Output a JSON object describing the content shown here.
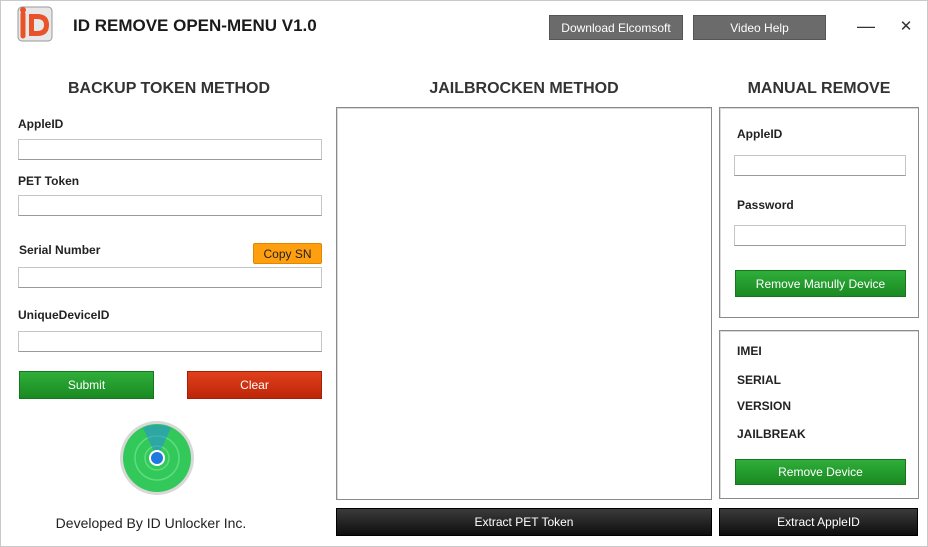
{
  "window": {
    "title": "ID REMOVE OPEN-MENU V1.0",
    "download_button": "Download Elcomsoft",
    "help_button": "Video Help",
    "minimize_symbol": "—",
    "close_symbol": "✕"
  },
  "backup": {
    "title": "BACKUP TOKEN METHOD",
    "appleid_label": "AppleID",
    "pet_label": "PET Token",
    "serial_label": "Serial Number",
    "copy_sn": "Copy SN",
    "udid_label": "UniqueDeviceID",
    "submit": "Submit",
    "clear": "Clear"
  },
  "jailbroken": {
    "title": "JAILBROCKEN METHOD",
    "extract_pet": "Extract PET Token"
  },
  "manual": {
    "title": "MANUAL REMOVE",
    "appleid_label": "AppleID",
    "password_label": "Password",
    "remove_manual": "Remove Manully Device",
    "imei_label": "IMEI",
    "serial_label": "SERIAL",
    "version_label": "VERSION",
    "jailbreak_label": "JAILBREAK",
    "remove_device": "Remove Device",
    "extract_appleid": "Extract AppleID"
  },
  "footer": "Developed By ID Unlocker Inc.",
  "colors": {
    "green": "#1f9a29",
    "red": "#cc2f10",
    "orange": "#ff9f0f",
    "dark": "#1a1a1a"
  },
  "icons": {
    "logo": "id-logo-icon",
    "find-my": "find-my-radar-icon"
  }
}
